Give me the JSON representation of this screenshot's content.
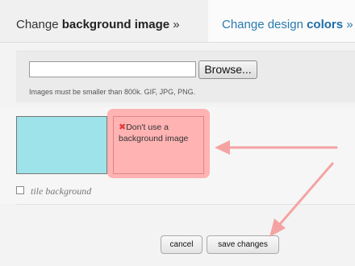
{
  "tabs": {
    "left": {
      "prefix": "Change ",
      "bold": "background image",
      "suffix": " »"
    },
    "right": {
      "prefix": "Change design ",
      "bold": "colors",
      "suffix": " »"
    }
  },
  "upload": {
    "file_value": "",
    "browse_label": "Browse...",
    "hint": "Images must be smaller than 800k. GIF, JPG, PNG."
  },
  "preview": {
    "swatch_color": "#9ee3ea"
  },
  "warning": {
    "icon": "x-icon",
    "text": "Don't use a background image"
  },
  "tile": {
    "checked": false,
    "label": "tile background"
  },
  "actions": {
    "cancel_label": "cancel",
    "save_label": "save changes"
  },
  "annotation_color": "#f4a3a3"
}
